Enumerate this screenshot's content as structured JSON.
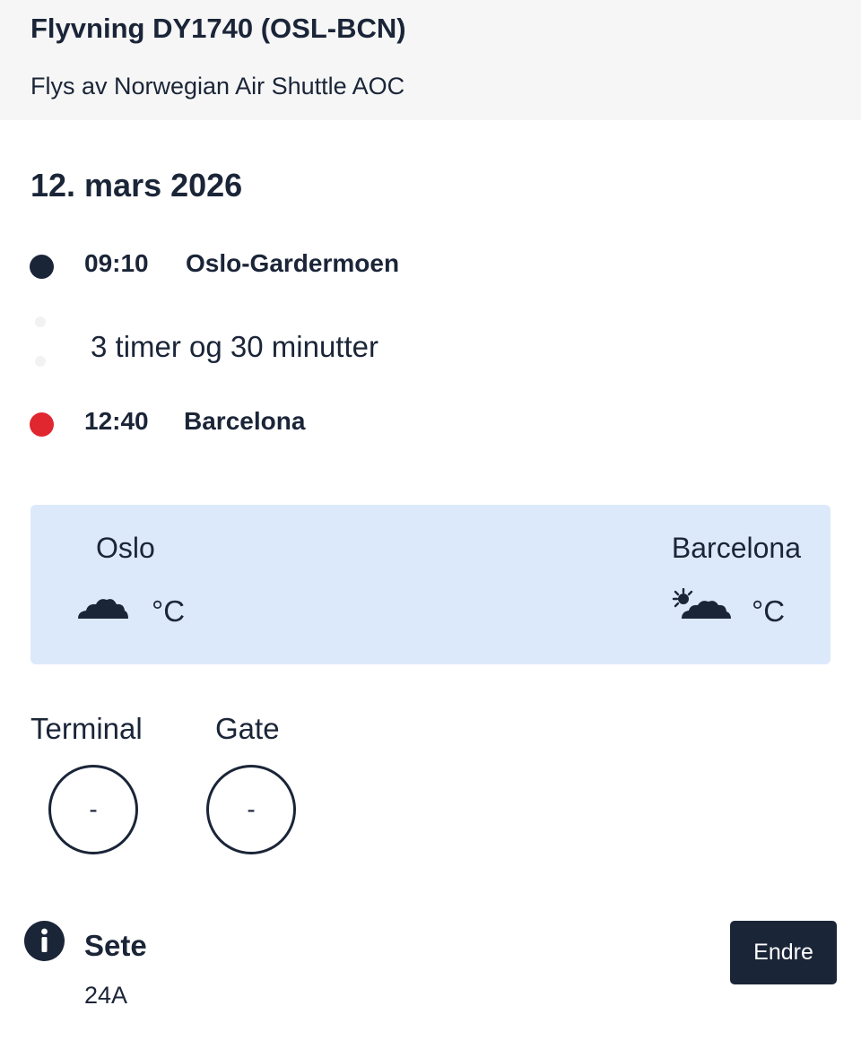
{
  "header": {
    "title": "Flyvning DY1740 (OSL-BCN)",
    "operator": "Flys av Norwegian Air Shuttle AOC"
  },
  "itinerary": {
    "date": "12. mars 2026",
    "departure": {
      "time": "09:10",
      "place": "Oslo-Gardermoen"
    },
    "duration": "3 timer og 30 minutter",
    "arrival": {
      "time": "12:40",
      "place": "Barcelona"
    }
  },
  "weather": {
    "origin": {
      "city": "Oslo",
      "icon": "cloud-icon",
      "unit": "°C"
    },
    "destination": {
      "city": "Barcelona",
      "icon": "partly-sunny-icon",
      "unit": "°C"
    }
  },
  "gate_info": {
    "terminal_label": "Terminal",
    "terminal_value": "-",
    "gate_label": "Gate",
    "gate_value": "-"
  },
  "seat": {
    "title": "Sete",
    "value": "24A",
    "change_label": "Endre",
    "icon": "info-icon"
  },
  "colors": {
    "text": "#1b2538",
    "header_bg": "#f6f6f6",
    "weather_bg": "#dce9fb",
    "departure_dot": "#1b2538",
    "arrival_dot": "#e0262e",
    "button_bg": "#1b2538"
  }
}
